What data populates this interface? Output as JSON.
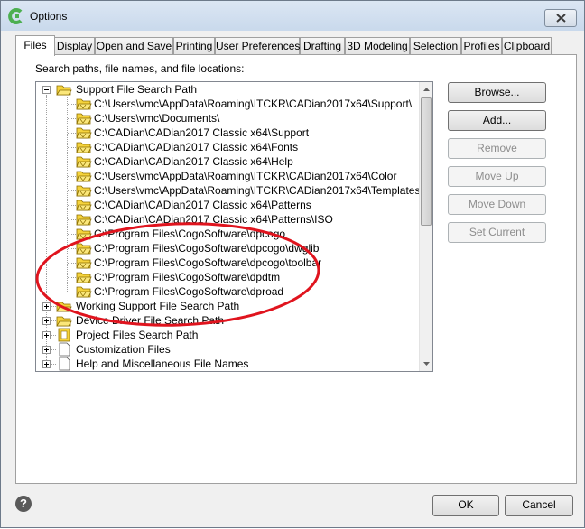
{
  "window": {
    "title": "Options"
  },
  "tabs": [
    {
      "label": "Files",
      "active": true
    },
    {
      "label": "Display"
    },
    {
      "label": "Open and Save"
    },
    {
      "label": "Printing"
    },
    {
      "label": "User Preferences"
    },
    {
      "label": "Drafting"
    },
    {
      "label": "3D Modeling"
    },
    {
      "label": "Selection"
    },
    {
      "label": "Profiles"
    },
    {
      "label": "Clipboard"
    }
  ],
  "panel": {
    "caption": "Search paths, file names, and file locations:"
  },
  "tree": {
    "root": "Support File Search Path",
    "paths": [
      "C:\\Users\\vmc\\AppData\\Roaming\\ITCKR\\CADian2017x64\\Support\\",
      "C:\\Users\\vmc\\Documents\\",
      "C:\\CADian\\CADian2017 Classic x64\\Support",
      "C:\\CADian\\CADian2017 Classic x64\\Fonts",
      "C:\\CADian\\CADian2017 Classic x64\\Help",
      "C:\\Users\\vmc\\AppData\\Roaming\\ITCKR\\CADian2017x64\\Color",
      "C:\\Users\\vmc\\AppData\\Roaming\\ITCKR\\CADian2017x64\\Templates",
      "C:\\CADian\\CADian2017 Classic x64\\Patterns",
      "C:\\CADian\\CADian2017 Classic x64\\Patterns\\ISO",
      "C:\\Program Files\\CogoSoftware\\dpcogo",
      "C:\\Program Files\\CogoSoftware\\dpcogo\\dwglib",
      "C:\\Program Files\\CogoSoftware\\dpcogo\\toolbar",
      "C:\\Program Files\\CogoSoftware\\dpdtm",
      "C:\\Program Files\\CogoSoftware\\dproad"
    ],
    "nodes": [
      "Working Support File Search Path",
      "Device Driver File Search Path",
      "Project Files Search Path",
      "Customization Files",
      "Help and Miscellaneous File Names"
    ]
  },
  "buttons": {
    "browse": "Browse...",
    "add": "Add...",
    "remove": "Remove",
    "move_up": "Move Up",
    "move_down": "Move Down",
    "set_current": "Set Current"
  },
  "footer": {
    "help": "?",
    "ok": "OK",
    "cancel": "Cancel"
  },
  "colors": {
    "annotation": "#e0141e",
    "folder": "#f5d33c",
    "titlebar": "#c9d9ec"
  }
}
